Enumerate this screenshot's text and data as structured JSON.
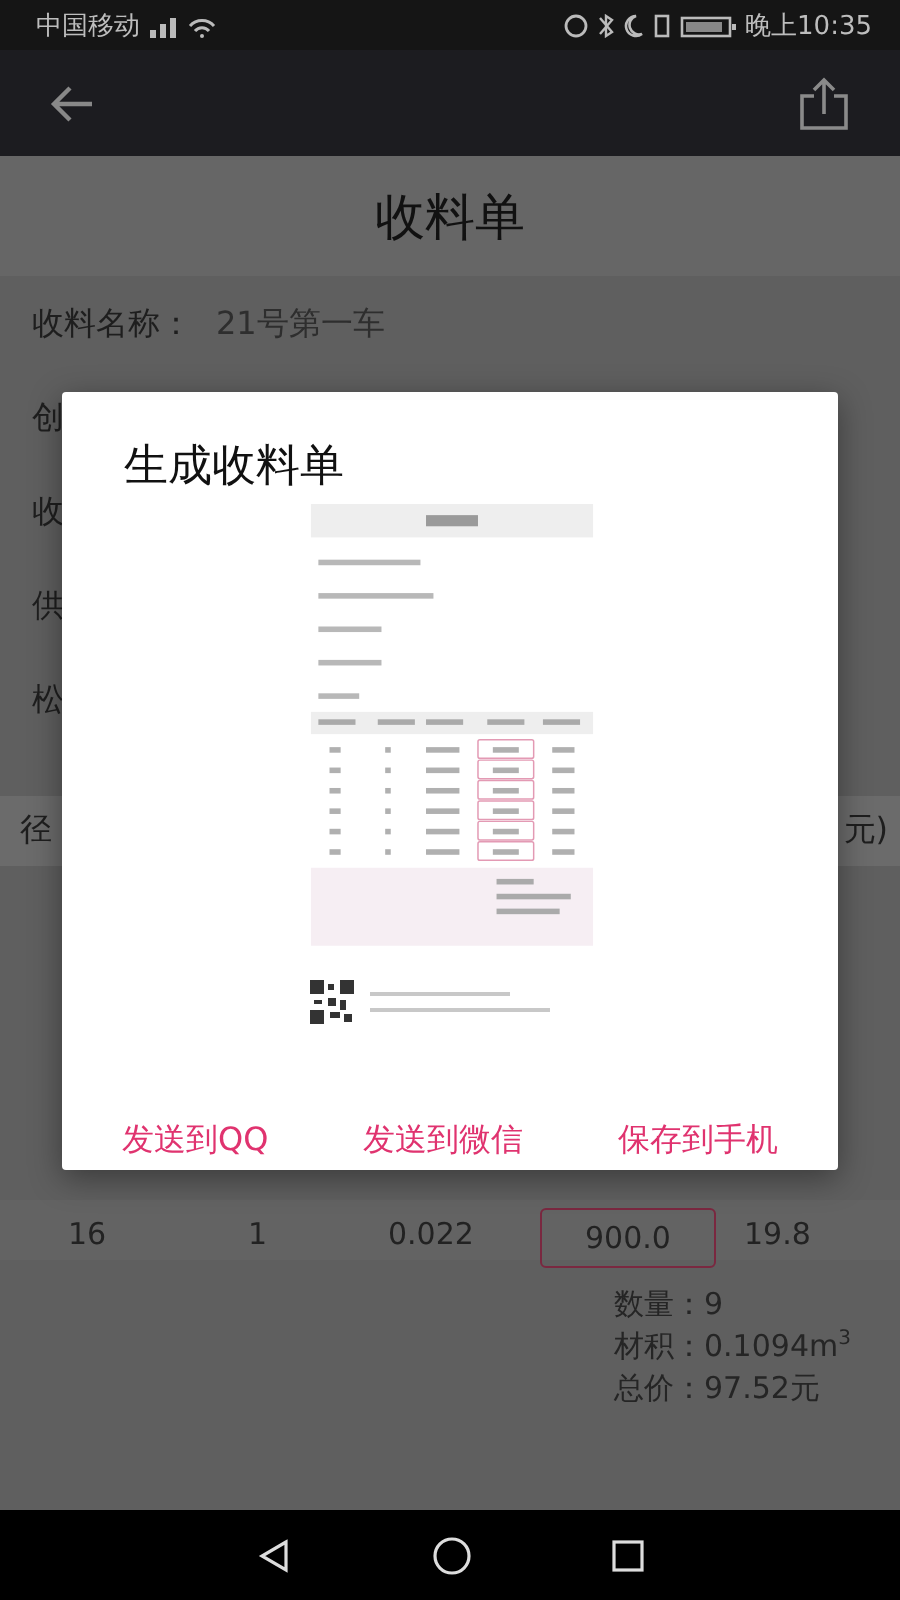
{
  "status_bar": {
    "carrier": "中国移动",
    "time": "晚上10:35"
  },
  "page": {
    "title": "收料单",
    "name_label": "收料名称：",
    "name_value": "21号第一车",
    "cut_labels": [
      "创",
      "收",
      "供",
      "松"
    ],
    "table_header_left": "径",
    "table_header_right": "元)",
    "last_row": [
      "16",
      "1",
      "0.022",
      "900.0",
      "19.8"
    ],
    "totals": [
      "数量：9",
      "材积：0.1094m$^{3}$",
      "总价：97.52元"
    ]
  },
  "dialog": {
    "title": "生成收料单",
    "actions": [
      "发送到QQ",
      "发送到微信",
      "保存到手机"
    ]
  }
}
